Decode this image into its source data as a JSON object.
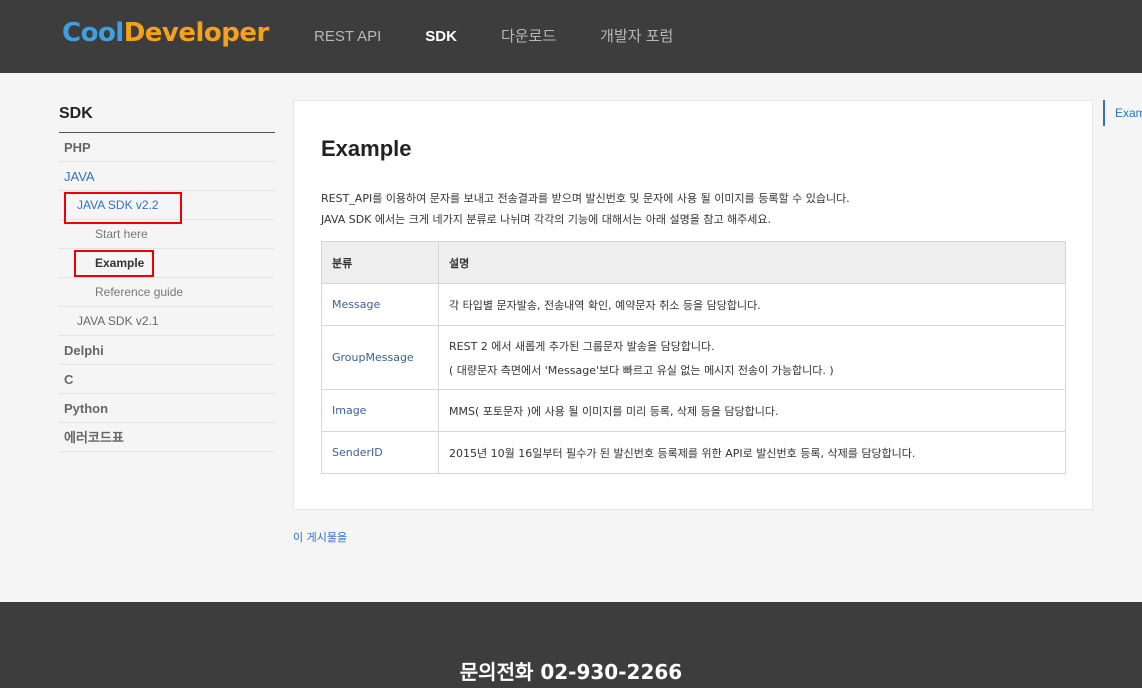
{
  "header": {
    "logo_part1": "Cool",
    "logo_part2": "Developer",
    "nav": [
      "REST API",
      "SDK",
      "다운로드",
      "개발자 포럼"
    ]
  },
  "sidebar": {
    "title": "SDK",
    "items": [
      "PHP",
      "JAVA",
      "JAVA SDK v2.2",
      "Start here",
      "Example",
      "Reference guide",
      "JAVA SDK v2.1",
      "Delphi",
      "C",
      "Python",
      "에러코드표"
    ]
  },
  "content": {
    "title": "Example",
    "desc1": "REST_API를 이용하여 문자를 보내고 전송결과를 받으며 발신번호 및 문자에 사용 될 이미지를 등록할 수 있습니다.",
    "desc2": "JAVA SDK 에서는 크게 네가지 분류로 나뉘며 각각의 기능에 대해서는 아래 설명을 참고 해주세요.",
    "table": {
      "headers": [
        "분류",
        "설명"
      ],
      "rows": [
        {
          "key": "Message",
          "desc": "각 타입별 문자발송, 전송내역 확인, 예약문자 취소 등을 담당합니다.",
          "desc2": ""
        },
        {
          "key": "GroupMessage",
          "desc": "REST 2 에서 새롭게 추가된 그룹문자 발송을 담당합니다.",
          "desc2": "( 대량문자 측면에서 'Message'보다 빠르고 유실 없는 메시지 전송이 가능합니다. )"
        },
        {
          "key": "Image",
          "desc": "MMS( 포토문자 )에 사용 될 이미지를 미리 등록, 삭제 등을 담당합니다.",
          "desc2": ""
        },
        {
          "key": "SenderID",
          "desc": "2015년 10월 16일부터 필수가 된 발신번호 등록제를 위한 API로 발신번호 등록, 삭제를 담당합니다.",
          "desc2": ""
        }
      ]
    },
    "after_link": "이 게시물을"
  },
  "toc": {
    "item": "Example"
  },
  "footer": {
    "phone": "문의전화 02-930-2266"
  },
  "colors": {
    "header_bg": "#3d3d3d",
    "accent": "#3370c4",
    "highlight": "#e00000",
    "logo_blue": "#3fa0e0",
    "logo_orange": "#f5a21b"
  }
}
